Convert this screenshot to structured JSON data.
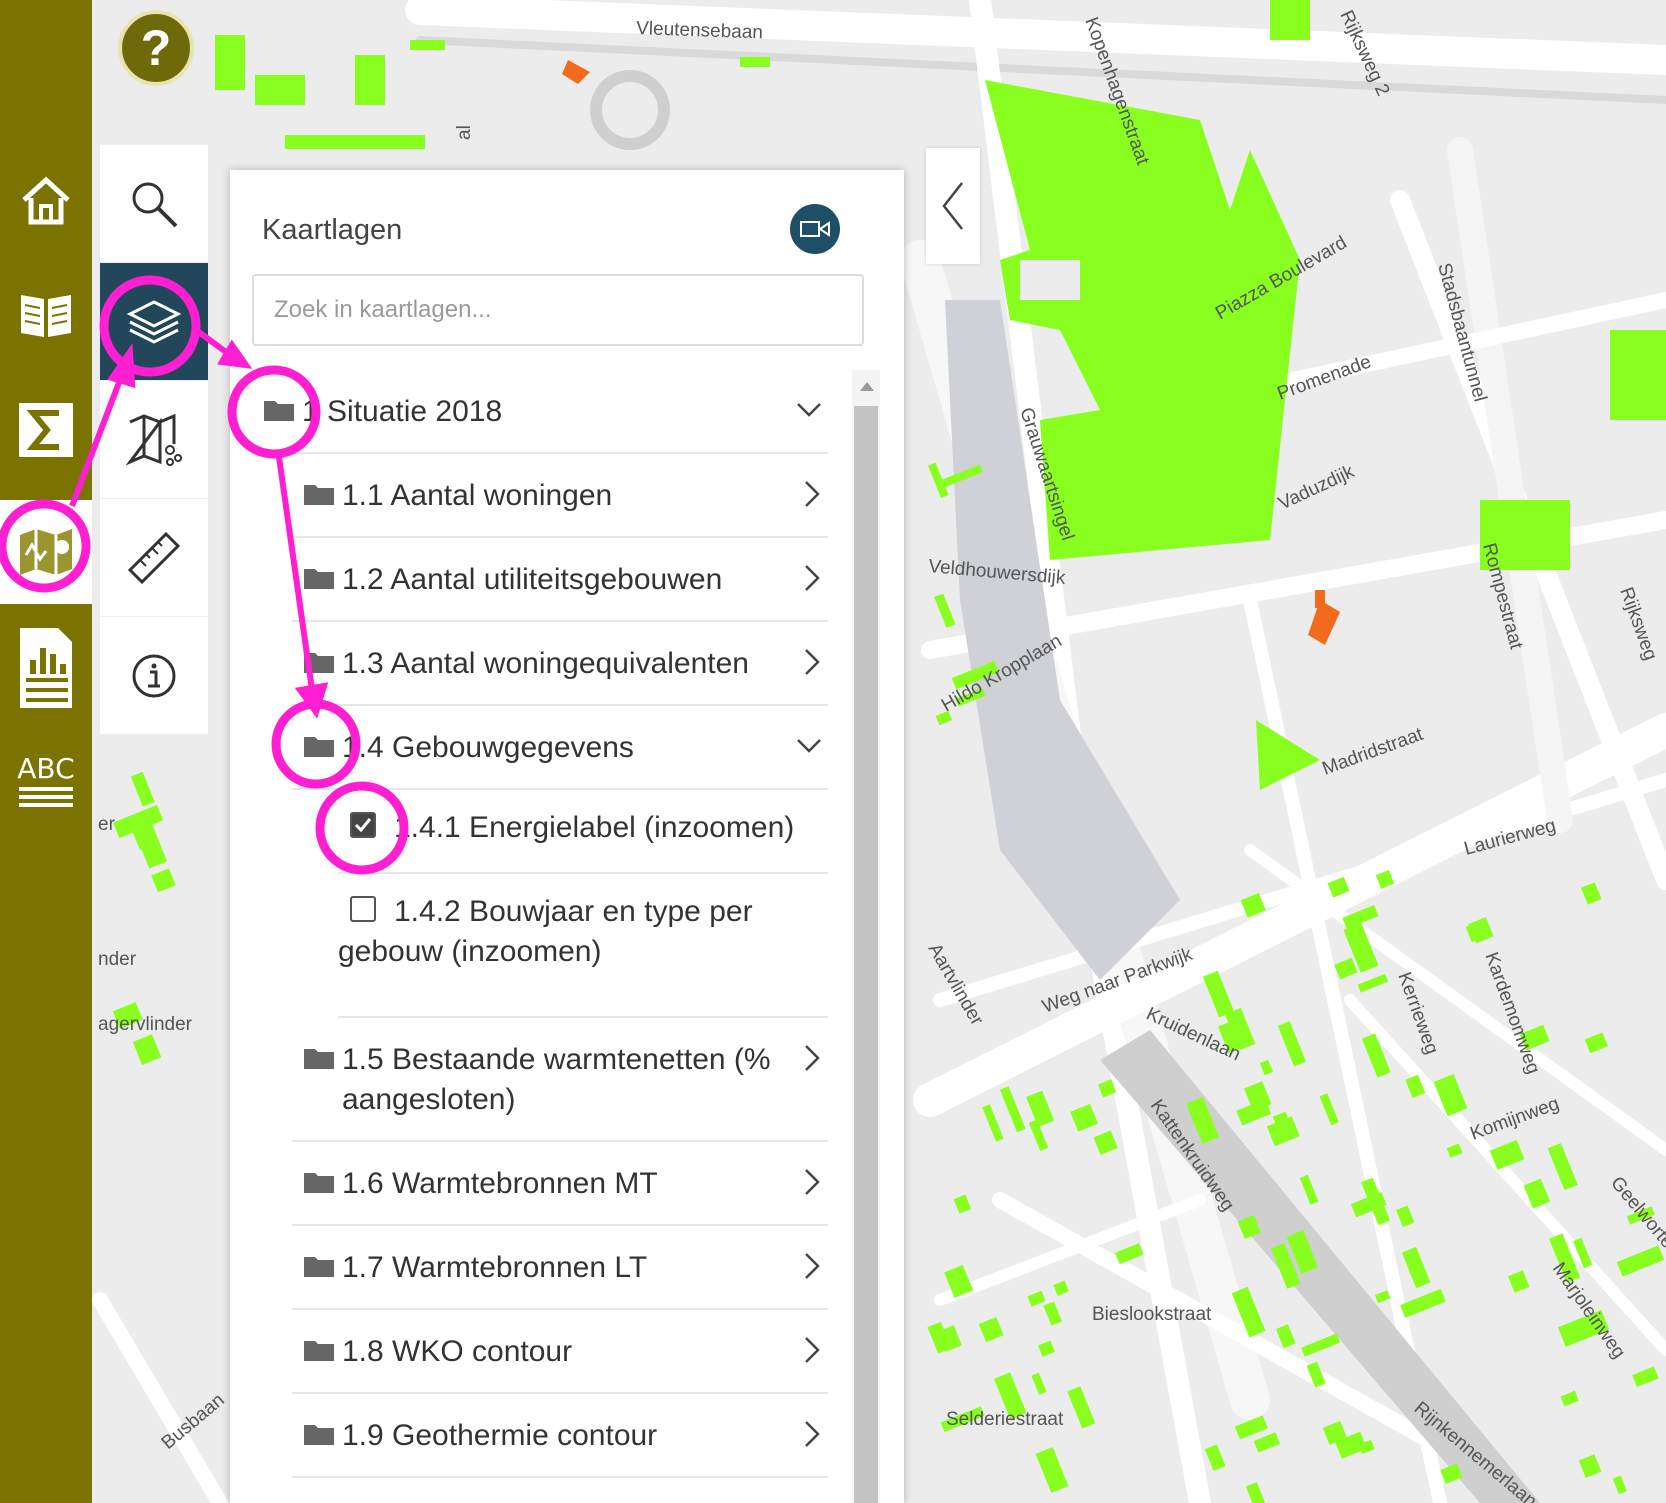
{
  "map": {
    "streets": [
      "Vleutensebaan",
      "Rijksweg 2",
      "Kopenhagenstraat",
      "Piazza Boulevard",
      "Promenade",
      "Stadsbaantunnel",
      "Vaduzdijk",
      "Grauwaartsingel",
      "Veldhouwersdijk",
      "Hildo Kropplaan",
      "Rompestraat",
      "Rijksweg",
      "Madridstraat",
      "Laurierweg",
      "Weg naar Parkwijk",
      "Kruidenlaan",
      "Kardemomweg",
      "Kerrieweg",
      "Komijnweg",
      "Kattenkruidweg",
      "Geelwortelweg",
      "Marjoleinweg",
      "Bieslookstraat",
      "Selderiestraat",
      "Rijnkennemerlaan",
      "Aartvlinder",
      "Busbaan"
    ],
    "partial_labels": [
      "al",
      "er",
      "nder",
      "agervlinder"
    ],
    "colors": {
      "buildings": "#88ff1f",
      "roads": "#ffffff",
      "base": "#ececec",
      "poi": "#f26b1d"
    }
  },
  "rail": {
    "color": "#7a7300",
    "items": [
      {
        "name": "home",
        "icon": "home-icon"
      },
      {
        "name": "book",
        "icon": "book-icon"
      },
      {
        "name": "statistics",
        "icon": "sigma-icon"
      },
      {
        "name": "maps",
        "icon": "map-icon",
        "active": true
      },
      {
        "name": "report",
        "icon": "report-icon"
      },
      {
        "name": "legend",
        "icon": "abc-icon",
        "label": "ABC"
      }
    ]
  },
  "help": {
    "label": "?"
  },
  "tools": [
    {
      "name": "search",
      "icon": "search-icon"
    },
    {
      "name": "layers",
      "icon": "layers-icon",
      "active": true
    },
    {
      "name": "map-share",
      "icon": "map-share-icon"
    },
    {
      "name": "measure",
      "icon": "ruler-icon"
    },
    {
      "name": "info",
      "icon": "info-icon"
    }
  ],
  "panel": {
    "title": "Kaartlagen",
    "search_placeholder": "Zoek in kaartlagen...",
    "video_icon": "video-icon",
    "layers": [
      {
        "label": "1 Situatie 2018",
        "expanded": true
      },
      {
        "label": "1.1 Aantal woningen",
        "expanded": false
      },
      {
        "label": "1.2 Aantal utiliteitsgebouwen",
        "expanded": false
      },
      {
        "label": "1.3 Aantal woningequivalenten",
        "expanded": false
      },
      {
        "label": "1.4 Gebouwgegevens",
        "expanded": true
      },
      {
        "label": "1.5 Bestaande warmtenetten (% aangesloten)",
        "expanded": false
      },
      {
        "label": "1.6 Warmtebronnen MT",
        "expanded": false
      },
      {
        "label": "1.7 Warmtebronnen LT",
        "expanded": false
      },
      {
        "label": "1.8 WKO contour",
        "expanded": false
      },
      {
        "label": "1.9 Geothermie contour",
        "expanded": false
      }
    ],
    "sublayers": [
      {
        "label": "1.4.1 Energielabel (inzoomen)",
        "checked": true
      },
      {
        "label": "1.4.2 Bouwjaar en type per gebouw (inzoomen)",
        "checked": false
      }
    ]
  },
  "annotation_color": "#ff1fd2"
}
